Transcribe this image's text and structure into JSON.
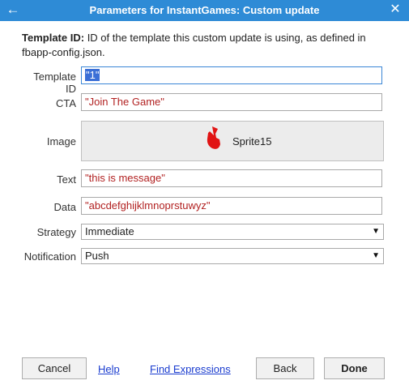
{
  "window": {
    "title": "Parameters for InstantGames: Custom update",
    "back_icon": "arrow-left-icon",
    "close_icon": "close-icon"
  },
  "description": {
    "label": "Template ID:",
    "text": "ID of the template this custom update is using, as defined in fbapp-config.json."
  },
  "fields": {
    "template_id": {
      "label": "Template ID",
      "value": "\"1\""
    },
    "cta": {
      "label": "CTA",
      "value": "\"Join The Game\""
    },
    "image": {
      "label": "Image",
      "value": "Sprite15",
      "icon": "sprite-icon"
    },
    "text": {
      "label": "Text",
      "value": "\"this is message\""
    },
    "data": {
      "label": "Data",
      "value": "\"abcdefghijklmnoprstuwyz\""
    },
    "strategy": {
      "label": "Strategy",
      "value": "Immediate"
    },
    "notification": {
      "label": "Notification",
      "value": "Push"
    }
  },
  "footer": {
    "cancel": "Cancel",
    "help": "Help",
    "find_expressions": "Find Expressions",
    "back": "Back",
    "done": "Done"
  },
  "colors": {
    "titlebar": "#2e8bd6",
    "value_text": "#b22222",
    "link": "#1a3ccf",
    "selection": "#3b6fd6"
  }
}
